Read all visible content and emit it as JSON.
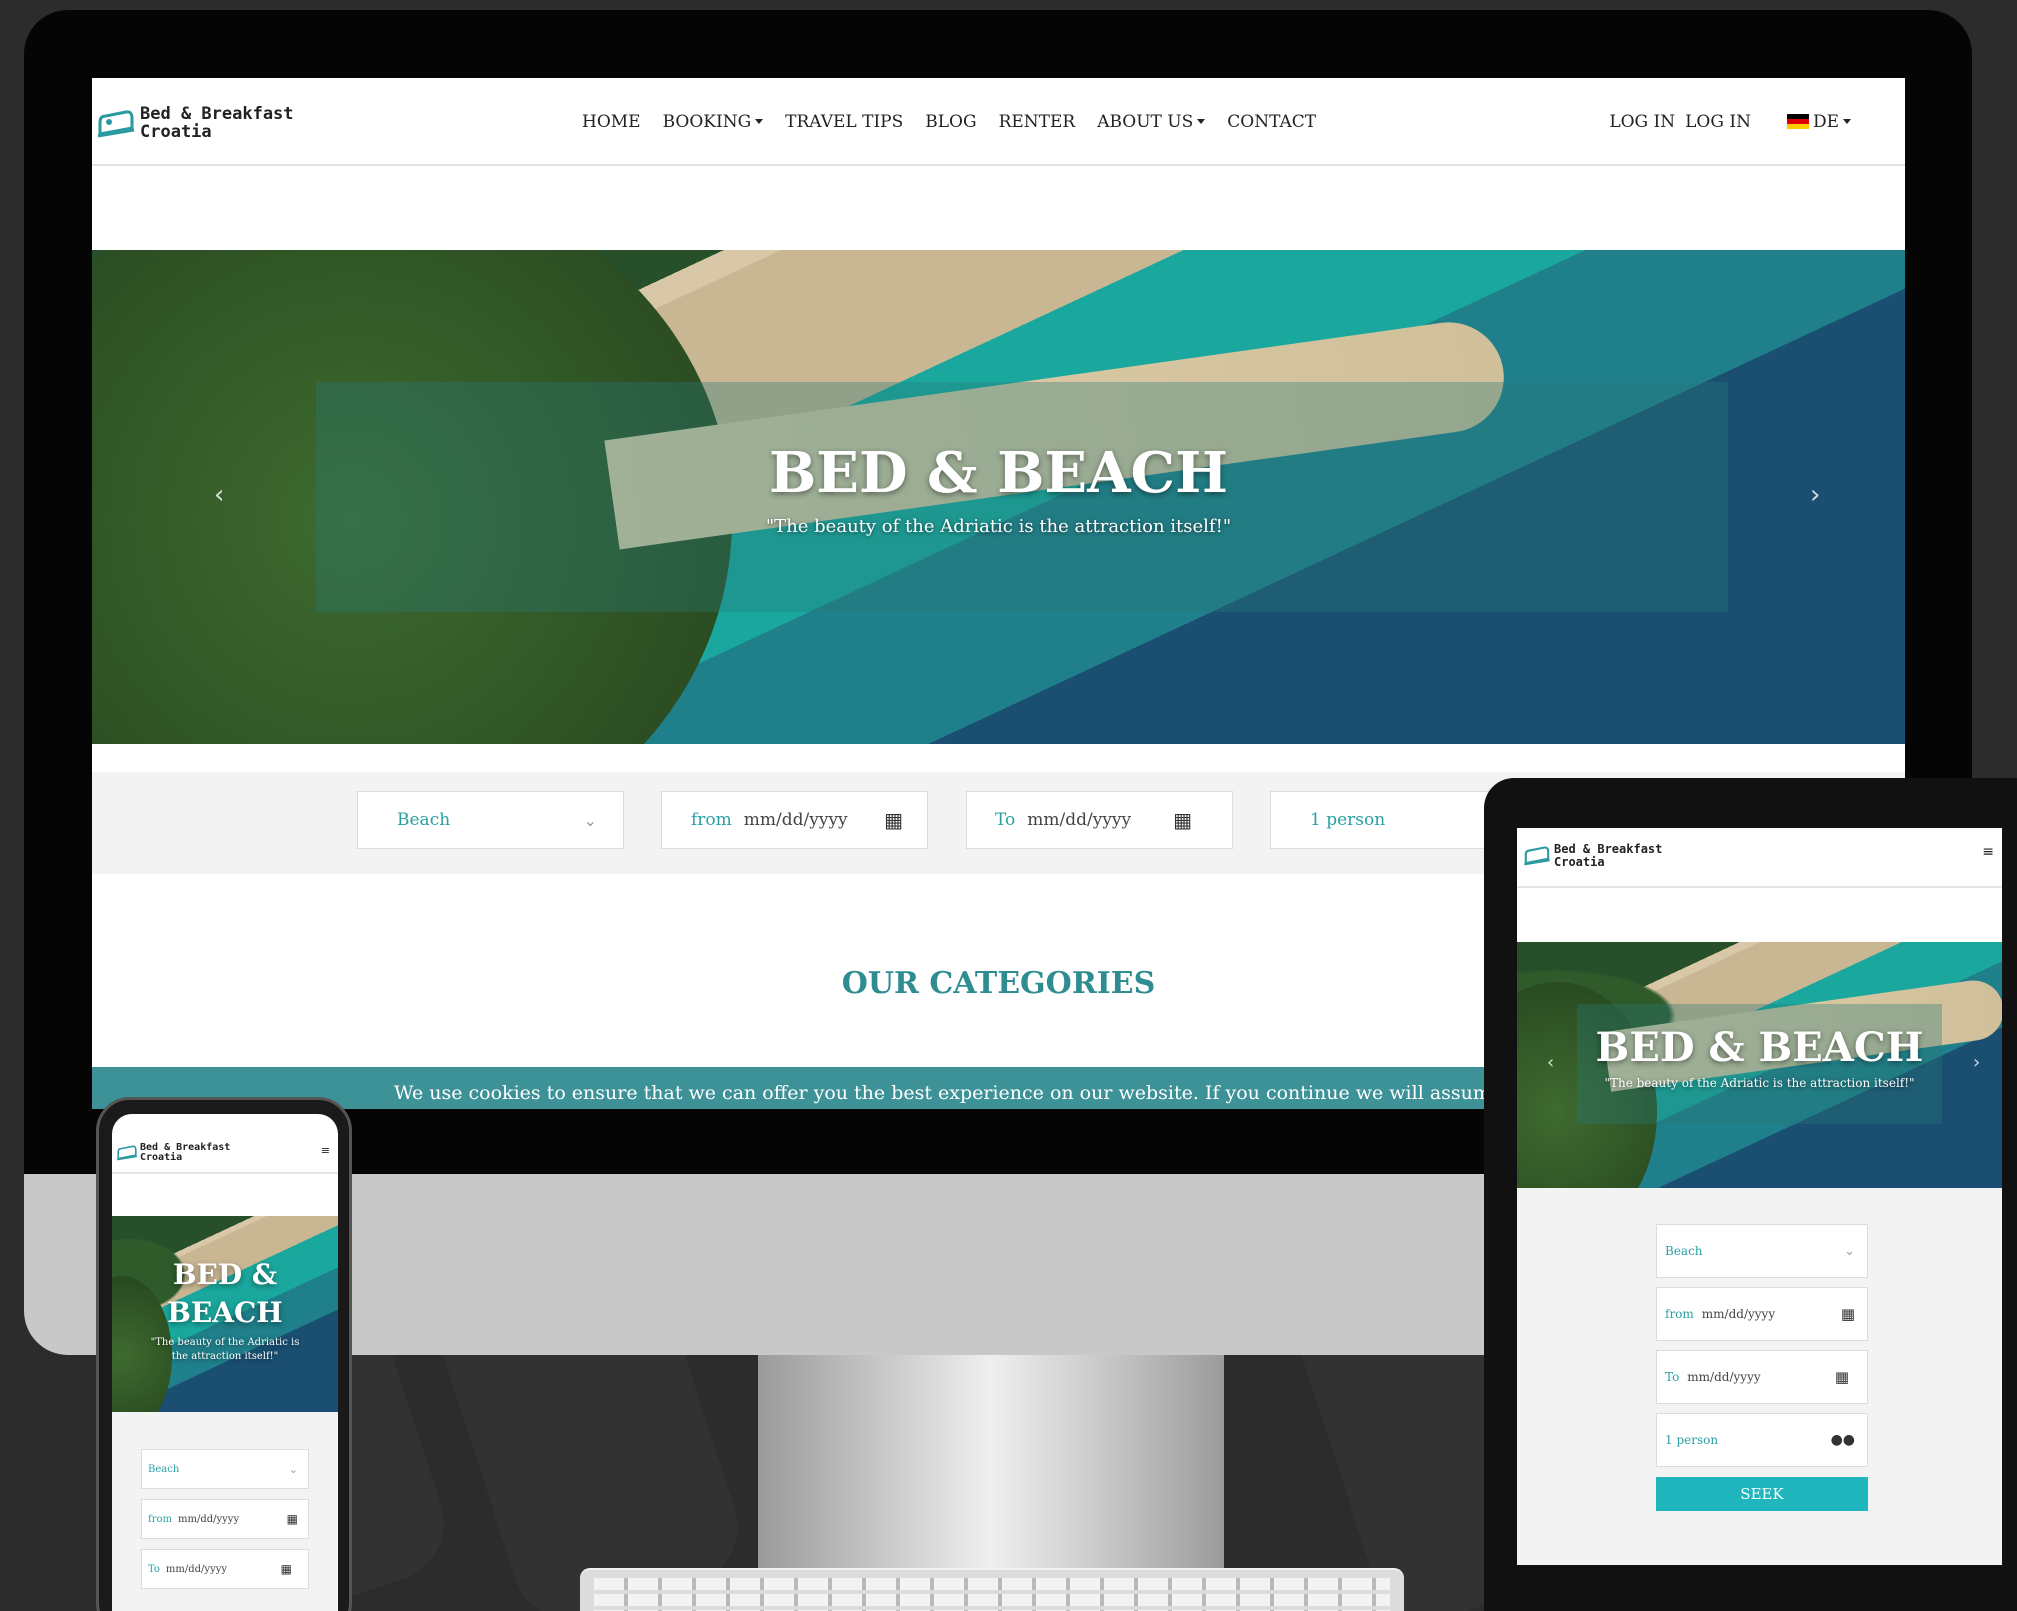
{
  "brand": {
    "line1": "Bed & Breakfast",
    "line2": "Croatia"
  },
  "nav": {
    "items": [
      {
        "label": "HOME",
        "dropdown": false
      },
      {
        "label": "BOOKING",
        "dropdown": true
      },
      {
        "label": "TRAVEL TIPS",
        "dropdown": false
      },
      {
        "label": "BLOG",
        "dropdown": false
      },
      {
        "label": "RENTER",
        "dropdown": false
      },
      {
        "label": "ABOUT US",
        "dropdown": true
      },
      {
        "label": "CONTACT",
        "dropdown": false
      }
    ],
    "login_1": "LOG IN",
    "login_2": "LOG IN",
    "language": "DE"
  },
  "hero": {
    "title": "BED & BEACH",
    "phone_title_line1": "BED &",
    "phone_title_line2": "BEACH",
    "subtitle": "\"The beauty of the Adriatic is the attraction itself!\"",
    "phone_subtitle_line1": "\"The beauty of the Adriatic is",
    "phone_subtitle_line2": "the attraction itself!\"",
    "prev_icon": "chevron-left-icon",
    "next_icon": "chevron-right-icon"
  },
  "search": {
    "category": "Beach",
    "from_label": "from",
    "from_placeholder": "mm/dd/yyyy",
    "to_label": "To",
    "to_placeholder": "mm/dd/yyyy",
    "persons": "1 person",
    "seek_label": "SEEK"
  },
  "categories_heading": "OUR CATEGORIES",
  "cookie_text": "We use cookies to ensure that we can offer you the best experience on our website. If you continue we will assume that you are h",
  "colors": {
    "accent": "#3d9297",
    "seek": "#1fb6bd",
    "heading": "#2f8d92"
  }
}
